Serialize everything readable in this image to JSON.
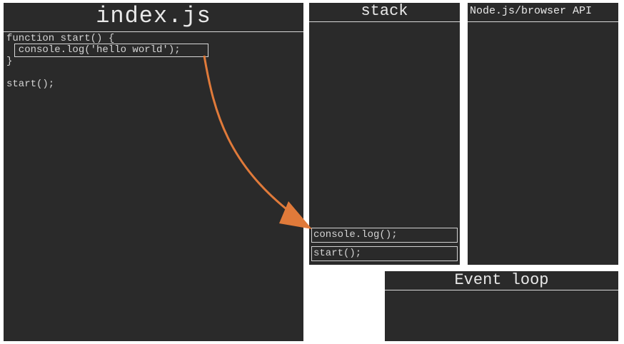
{
  "editor": {
    "title": "index.js",
    "code": {
      "line1": "function start() {",
      "line2": "  console.log('hello world');",
      "line3": "}",
      "line5": "start();"
    }
  },
  "stack": {
    "title": "stack",
    "frames": [
      "console.log();",
      "start();"
    ]
  },
  "api": {
    "title": "Node.js/browser API"
  },
  "event_loop": {
    "title": "Event loop"
  },
  "colors": {
    "panel": "#2a2a2a",
    "text": "#d4d4d4",
    "arrow": "#e07a3a"
  }
}
